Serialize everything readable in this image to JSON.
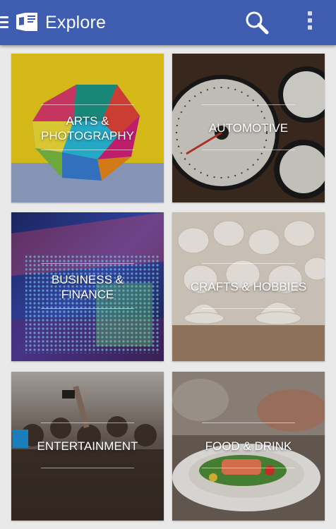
{
  "app_bar": {
    "title": "Explore",
    "background": "#3f5db0",
    "icons": {
      "menu": "menu-icon",
      "logo": "app-logo",
      "search": "search-icon",
      "overflow": "overflow-icon"
    }
  },
  "categories": [
    {
      "label": "ARTS & PHOTOGRAPHY"
    },
    {
      "label": "AUTOMOTIVE"
    },
    {
      "label": "BUSINESS & FINANCE"
    },
    {
      "label": "CRAFTS & HOBBIES"
    },
    {
      "label": "ENTERTAINMENT"
    },
    {
      "label": "FOOD & DRINK"
    }
  ]
}
